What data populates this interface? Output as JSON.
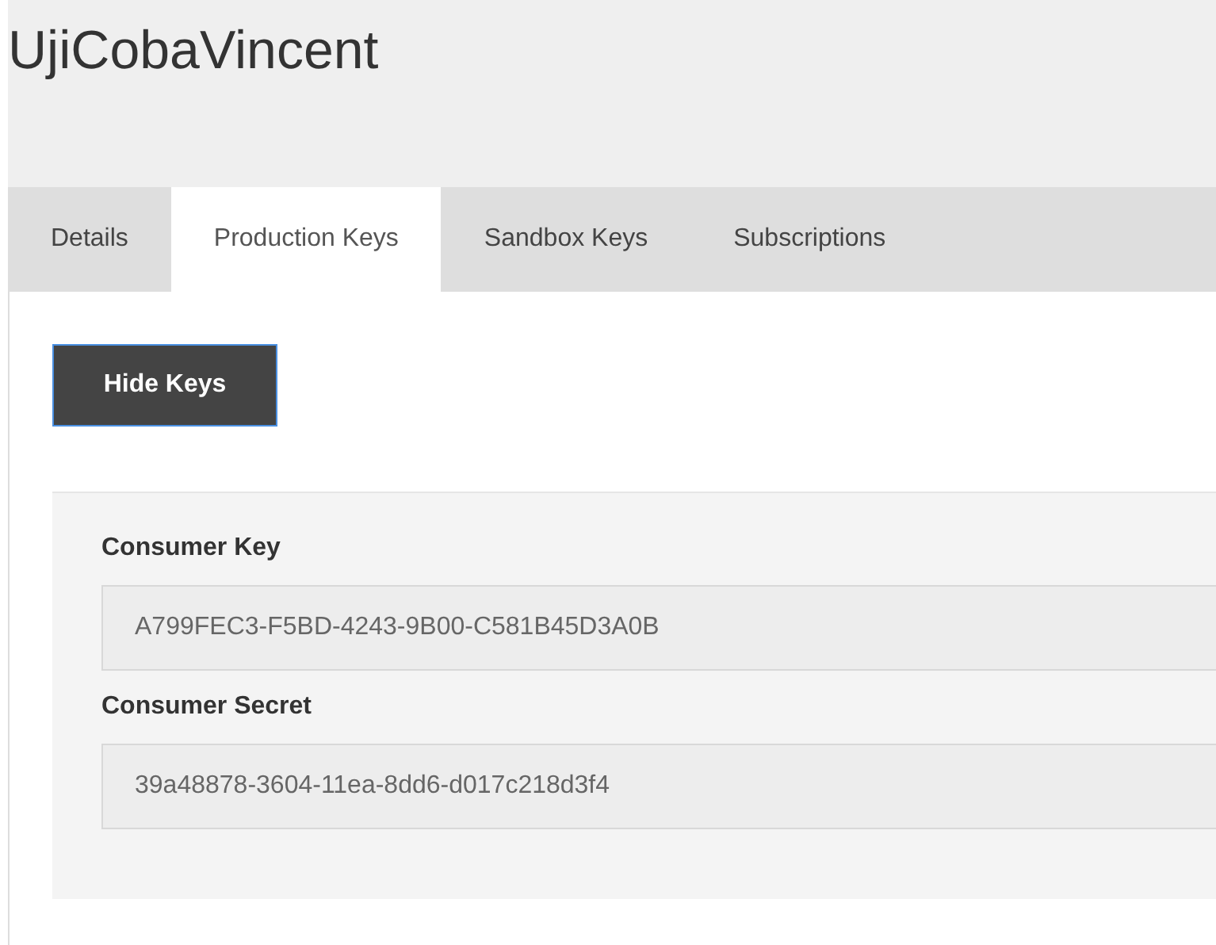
{
  "app_title": "UjiCobaVincent",
  "tabs": [
    {
      "label": "Details",
      "selected": false
    },
    {
      "label": "Production Keys",
      "selected": true
    },
    {
      "label": "Sandbox Keys",
      "selected": false
    },
    {
      "label": "Subscriptions",
      "selected": false
    }
  ],
  "toggle_button": "Hide Keys",
  "fields": [
    {
      "label": "Consumer Key",
      "value": "A799FEC3-F5BD-4243-9B00-C581B45D3A0B"
    },
    {
      "label": "Consumer Secret",
      "value": "39a48878-3604-11ea-8dd6-d017c218d3f4"
    }
  ]
}
